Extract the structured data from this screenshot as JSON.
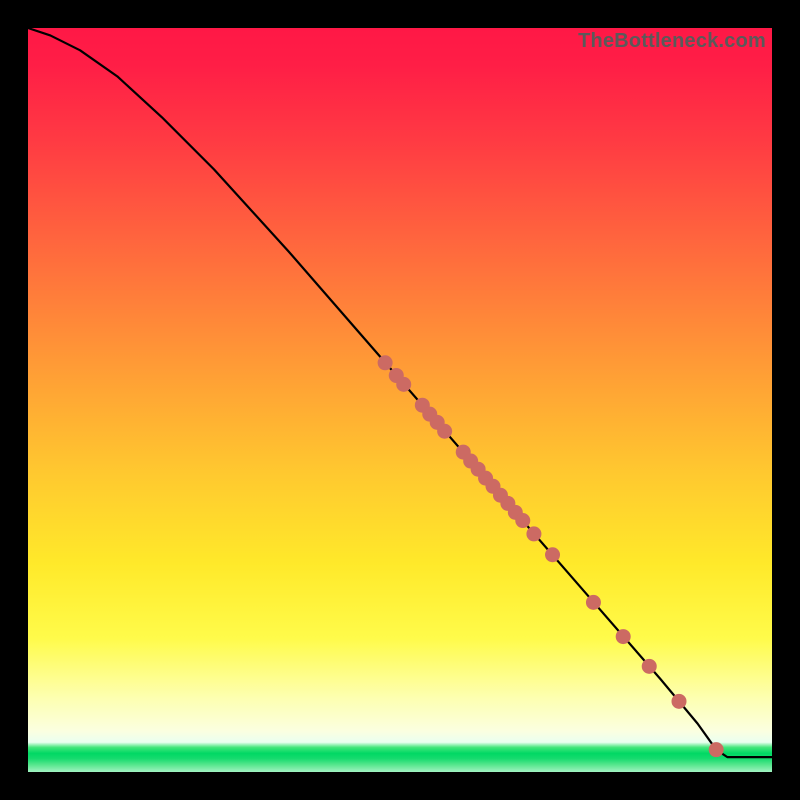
{
  "watermark": "TheBottleneck.com",
  "colors": {
    "curve_stroke": "#000000",
    "point_fill": "#cc6a63",
    "point_stroke": "#cc6a63"
  },
  "chart_data": {
    "type": "line",
    "title": "",
    "xlabel": "",
    "ylabel": "",
    "xlim": [
      0,
      100
    ],
    "ylim": [
      0,
      100
    ],
    "grid": false,
    "legend": false,
    "series": [
      {
        "name": "bottleneck-curve",
        "x": [
          0,
          3,
          7,
          12,
          18,
          25,
          35,
          45,
          55,
          65,
          75,
          85,
          90,
          92.5,
          94,
          100
        ],
        "y": [
          100,
          99,
          97,
          93.5,
          88,
          81,
          70,
          58.5,
          47,
          35.5,
          24,
          12.5,
          6.5,
          3,
          2,
          2
        ]
      }
    ],
    "points": [
      {
        "x": 48.0,
        "y": 55.0
      },
      {
        "x": 49.5,
        "y": 53.3
      },
      {
        "x": 50.5,
        "y": 52.1
      },
      {
        "x": 53.0,
        "y": 49.3
      },
      {
        "x": 54.0,
        "y": 48.1
      },
      {
        "x": 55.0,
        "y": 47.0
      },
      {
        "x": 56.0,
        "y": 45.8
      },
      {
        "x": 58.5,
        "y": 43.0
      },
      {
        "x": 59.5,
        "y": 41.8
      },
      {
        "x": 60.5,
        "y": 40.7
      },
      {
        "x": 61.5,
        "y": 39.5
      },
      {
        "x": 62.5,
        "y": 38.4
      },
      {
        "x": 63.5,
        "y": 37.2
      },
      {
        "x": 64.5,
        "y": 36.1
      },
      {
        "x": 65.5,
        "y": 34.9
      },
      {
        "x": 66.5,
        "y": 33.8
      },
      {
        "x": 68.0,
        "y": 32.0
      },
      {
        "x": 70.5,
        "y": 29.2
      },
      {
        "x": 76.0,
        "y": 22.8
      },
      {
        "x": 80.0,
        "y": 18.2
      },
      {
        "x": 83.5,
        "y": 14.2
      },
      {
        "x": 87.5,
        "y": 9.5
      },
      {
        "x": 92.5,
        "y": 3.0
      }
    ]
  }
}
